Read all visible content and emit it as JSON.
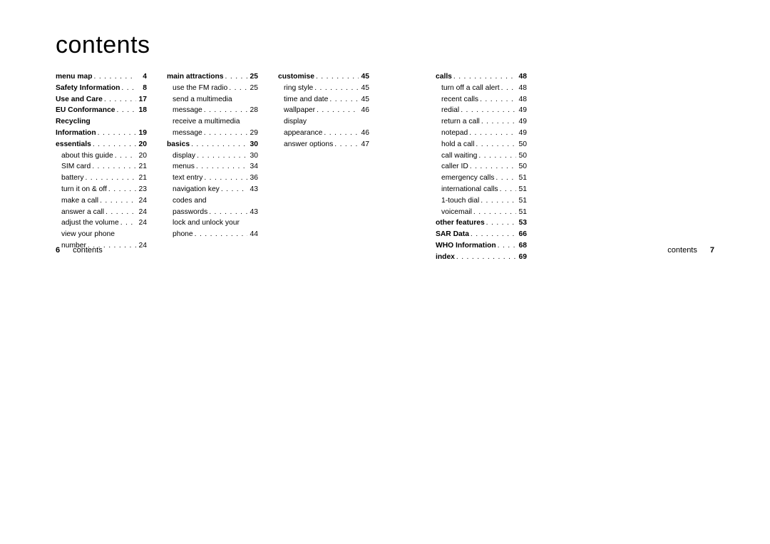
{
  "heading": "contents",
  "footer": {
    "left_num": "6",
    "left_label": "contents",
    "right_label": "contents",
    "right_num": "7"
  },
  "cols": [
    [
      {
        "label": "menu map",
        "page": "4",
        "bold": true
      },
      {
        "label": "Safety Information",
        "page": "8",
        "bold": true
      },
      {
        "label": "Use and Care",
        "page": "17",
        "bold": true
      },
      {
        "label": "EU Conformance",
        "page": "18",
        "bold": true
      },
      {
        "label": "Recycling",
        "page": "",
        "bold": true,
        "nodots": true
      },
      {
        "label": "Information",
        "page": "19",
        "bold": true
      },
      {
        "label": "essentials",
        "page": "20",
        "bold": true
      },
      {
        "label": "about this guide",
        "page": "20",
        "sub": true
      },
      {
        "label": "SIM card",
        "page": "21",
        "sub": true
      },
      {
        "label": "battery",
        "page": "21",
        "sub": true
      },
      {
        "label": "turn it on & off",
        "page": "23",
        "sub": true
      },
      {
        "label": "make a call",
        "page": "24",
        "sub": true
      },
      {
        "label": "answer a call",
        "page": "24",
        "sub": true
      },
      {
        "label": "adjust the volume",
        "page": "24",
        "sub": true
      },
      {
        "label": "view your phone",
        "page": "",
        "sub": true,
        "nodots": true
      },
      {
        "label": "number",
        "page": "24",
        "sub": true
      }
    ],
    [
      {
        "label": "main attractions",
        "page": "25",
        "bold": true
      },
      {
        "label": "use the FM radio",
        "page": "25",
        "sub": true
      },
      {
        "label": "send a multimedia",
        "page": "",
        "sub": true,
        "nodots": true
      },
      {
        "label": "message",
        "page": "28",
        "sub": true
      },
      {
        "label": "receive a multimedia",
        "page": "",
        "sub": true,
        "nodots": true
      },
      {
        "label": "message",
        "page": "29",
        "sub": true
      },
      {
        "label": "basics",
        "page": "30",
        "bold": true
      },
      {
        "label": "display",
        "page": "30",
        "sub": true
      },
      {
        "label": "menus",
        "page": "34",
        "sub": true
      },
      {
        "label": "text entry",
        "page": "36",
        "sub": true
      },
      {
        "label": "navigation key",
        "page": "43",
        "sub": true
      },
      {
        "label": "codes and",
        "page": "",
        "sub": true,
        "nodots": true
      },
      {
        "label": "passwords",
        "page": "43",
        "sub": true
      },
      {
        "label": "lock and unlock your",
        "page": "",
        "sub": true,
        "nodots": true
      },
      {
        "label": "phone",
        "page": "44",
        "sub": true
      }
    ],
    [
      {
        "label": "customise",
        "page": "45",
        "bold": true
      },
      {
        "label": "ring style",
        "page": "45",
        "sub": true
      },
      {
        "label": "time and date",
        "page": "45",
        "sub": true
      },
      {
        "label": "wallpaper",
        "page": "46",
        "sub": true
      },
      {
        "label": "display",
        "page": "",
        "sub": true,
        "nodots": true
      },
      {
        "label": "appearance",
        "page": "46",
        "sub": true
      },
      {
        "label": "answer options",
        "page": "47",
        "sub": true
      }
    ],
    [
      {
        "label": "calls",
        "page": "48",
        "bold": true
      },
      {
        "label": "turn off a call alert",
        "page": "48",
        "sub": true
      },
      {
        "label": "recent calls",
        "page": "48",
        "sub": true
      },
      {
        "label": "redial",
        "page": "49",
        "sub": true
      },
      {
        "label": "return a call",
        "page": "49",
        "sub": true
      },
      {
        "label": "notepad",
        "page": "49",
        "sub": true
      },
      {
        "label": "hold a call",
        "page": "50",
        "sub": true
      },
      {
        "label": "call waiting",
        "page": "50",
        "sub": true
      },
      {
        "label": "caller ID",
        "page": "50",
        "sub": true
      },
      {
        "label": "emergency calls",
        "page": "51",
        "sub": true
      },
      {
        "label": "international calls",
        "page": "51",
        "sub": true
      },
      {
        "label": "1-touch dial",
        "page": "51",
        "sub": true
      },
      {
        "label": "voicemail",
        "page": "51",
        "sub": true
      },
      {
        "label": "other features",
        "page": "53",
        "bold": true
      },
      {
        "label": "SAR Data",
        "page": "66",
        "bold": true
      },
      {
        "label": "WHO Information",
        "page": "68",
        "bold": true
      },
      {
        "label": "index",
        "page": "69",
        "bold": true
      }
    ]
  ]
}
